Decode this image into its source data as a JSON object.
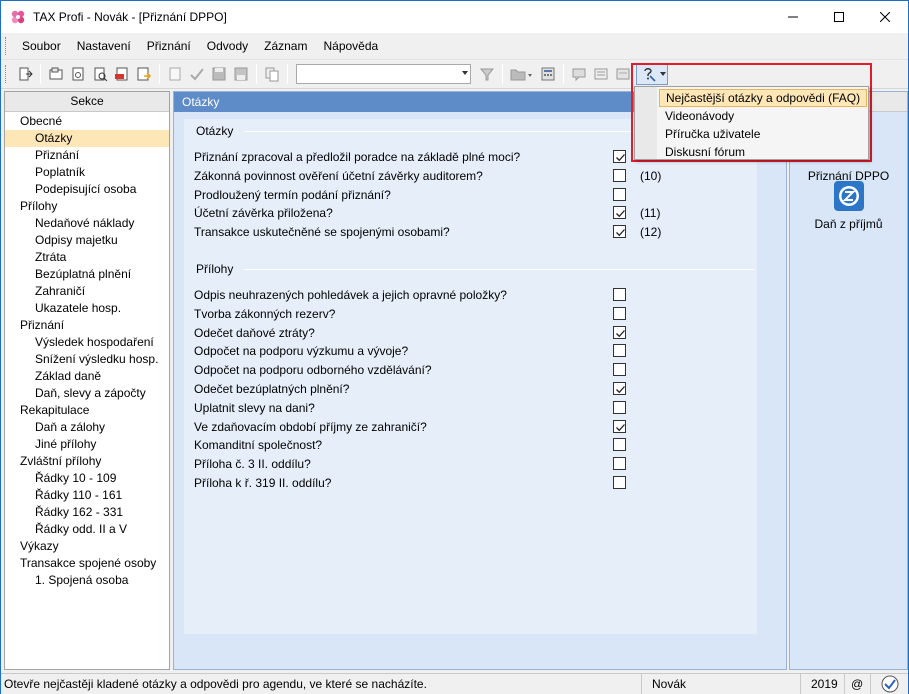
{
  "window": {
    "title": "TAX Profi - Novák - [Přiznání DPPO]"
  },
  "menu": [
    "Soubor",
    "Nastavení",
    "Přiznání",
    "Odvody",
    "Záznam",
    "Nápověda"
  ],
  "toolbar": {
    "combo_value": ""
  },
  "help_dropdown": {
    "items": [
      {
        "label": "Nejčastější otázky a odpovědi (FAQ)",
        "active": true
      },
      {
        "label": "Videonávody",
        "active": false
      },
      {
        "label": "Příručka uživatele",
        "active": false
      },
      {
        "label": "Diskusní fórum",
        "active": false
      }
    ]
  },
  "left_panel": {
    "header": "Sekce",
    "tree": [
      {
        "label": "Obecné",
        "level": 0
      },
      {
        "label": "Otázky",
        "level": 1,
        "selected": true
      },
      {
        "label": "Přiznání",
        "level": 1
      },
      {
        "label": "Poplatník",
        "level": 1
      },
      {
        "label": "Podepisující osoba",
        "level": 1
      },
      {
        "label": "Přílohy",
        "level": 0
      },
      {
        "label": "Nedaňové náklady",
        "level": 1
      },
      {
        "label": "Odpisy majetku",
        "level": 1
      },
      {
        "label": "Ztráta",
        "level": 1
      },
      {
        "label": "Bezúplatná plnění",
        "level": 1
      },
      {
        "label": "Zahraničí",
        "level": 1
      },
      {
        "label": "Ukazatele hosp.",
        "level": 1
      },
      {
        "label": "Přiznání",
        "level": 0
      },
      {
        "label": "Výsledek hospodaření",
        "level": 1
      },
      {
        "label": "Snížení výsledku hosp.",
        "level": 1
      },
      {
        "label": "Základ daně",
        "level": 1
      },
      {
        "label": "Daň, slevy a zápočty",
        "level": 1
      },
      {
        "label": "Rekapitulace",
        "level": 0
      },
      {
        "label": "Daň a zálohy",
        "level": 1
      },
      {
        "label": "Jiné přílohy",
        "level": 1
      },
      {
        "label": "Zvláštní přílohy",
        "level": 0
      },
      {
        "label": "Řádky 10 - 109",
        "level": 1
      },
      {
        "label": "Řádky 110 - 161",
        "level": 1
      },
      {
        "label": "Řádky 162 - 331",
        "level": 1
      },
      {
        "label": "Řádky odd. II a V",
        "level": 1
      },
      {
        "label": "Výkazy",
        "level": 0
      },
      {
        "label": "Transakce spojené osoby",
        "level": 0
      },
      {
        "label": "1. Spojená osoba",
        "level": 1
      }
    ]
  },
  "center_panel": {
    "header": "Otázky",
    "groups": [
      {
        "title": "Otázky",
        "questions": [
          {
            "label": "Přiznání zpracoval a předložil poradce na základě plné moci?",
            "checked": true,
            "note": ""
          },
          {
            "label": "Zákonná povinnost ověření účetní závěrky auditorem?",
            "checked": false,
            "note": "(10)"
          },
          {
            "label": "Prodloužený termín podání přiznání?",
            "checked": false,
            "note": ""
          },
          {
            "label": "Účetní závěrka přiložena?",
            "checked": true,
            "note": "(11)"
          },
          {
            "label": "Transakce uskutečněné se spojenými osobami?",
            "checked": true,
            "note": "(12)"
          }
        ]
      },
      {
        "title": "Přílohy",
        "questions": [
          {
            "label": "Odpis neuhrazených pohledávek a jejich opravné položky?",
            "checked": false,
            "note": ""
          },
          {
            "label": "Tvorba zákonných rezerv?",
            "checked": false,
            "note": ""
          },
          {
            "label": "Odečet daňové ztráty?",
            "checked": true,
            "note": ""
          },
          {
            "label": "Odpočet na podporu výzkumu a vývoje?",
            "checked": false,
            "note": ""
          },
          {
            "label": "Odpočet na podporu odborného vzdělávání?",
            "checked": false,
            "note": ""
          },
          {
            "label": "Odečet bezúplatných plnění?",
            "checked": true,
            "note": ""
          },
          {
            "label": "Uplatnit slevy na dani?",
            "checked": false,
            "note": ""
          },
          {
            "label": "Ve zdaňovacím období příjmy ze zahraničí?",
            "checked": true,
            "note": ""
          },
          {
            "label": "Komanditní společnost?",
            "checked": false,
            "note": ""
          },
          {
            "label": "Příloha č. 3 II. oddílu?",
            "checked": false,
            "note": ""
          },
          {
            "label": "Příloha k ř. 319 II. oddílu?",
            "checked": false,
            "note": ""
          }
        ]
      }
    ]
  },
  "right_panel": {
    "agendas": [
      {
        "label": "Přiznání DPPO",
        "icon": "edit-pencil-icon"
      },
      {
        "label": "Daň z příjmů",
        "icon": "tax-logo-icon"
      }
    ]
  },
  "statusbar": {
    "message": "Otevře nejčastěji kladené otázky a odpovědi pro agendu, ve které se nacházíte.",
    "user": "Novák",
    "year": "2019",
    "at": "@"
  },
  "colors": {
    "accent_blue": "#5e8cc9",
    "selection": "#fde7b7",
    "highlight_outline": "#e21c2a",
    "panel_bg": "#d8e6f8"
  }
}
